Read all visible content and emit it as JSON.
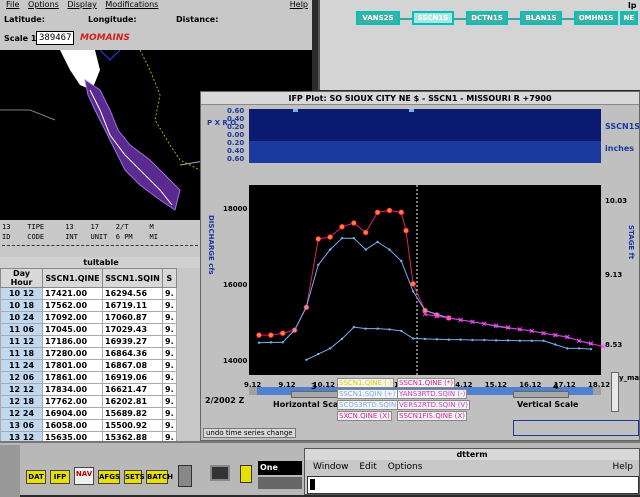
{
  "map": {
    "menu": [
      "File",
      "Options",
      "Display",
      "Modifications"
    ],
    "coords": {
      "lat": "Latitude:",
      "lon": "Longitude:",
      "dist": "Distance:"
    },
    "scale_label": "Scale 1:",
    "scale_value": "389467",
    "scale_unit": "MOMAINS",
    "help": "Help"
  },
  "tree": {
    "help": "lp",
    "nodes": [
      "VANS2S",
      "SSCN1S",
      "DCTN1S",
      "BLAN1S",
      "OMHN1S",
      "NE"
    ]
  },
  "ifp": {
    "title": "IFP Plot: SO SIOUX CITY NE   $ - SSCN1  -  MISSOURI R   +7900",
    "precip_label": "P X R O",
    "precip_ticks": [
      "0.60",
      "0.40",
      "0.20",
      "0.00",
      "0.20",
      "0.40",
      "0.60"
    ],
    "right_label": "SSCN1S",
    "unit_label": "inches",
    "yaxis_left": "DISCHARGE cfs",
    "yaxis_right": "STAGE ft",
    "yticks_left": [
      "18000",
      "16000",
      "14000"
    ],
    "yticks_right": [
      "10.03",
      "9.13",
      "8.53"
    ],
    "xticks": [
      "9.12",
      "9.12",
      "10.12",
      "11.12",
      "12.12",
      "13.12",
      "14.12",
      "15.12",
      "16.12",
      "17.12",
      "18.12"
    ],
    "horizontal_scale_label": "Horizontal Scale",
    "horizontal_scale_value": "3",
    "vertical_scale_label": "Vertical Scale",
    "vertical_scale_value": "4",
    "date_label": "2/2002 Z",
    "undo_label": "undo time series change",
    "y_max_label": "y_max",
    "legend": [
      {
        "label": "SSCN1.QINE (-)",
        "color": "#e8d000"
      },
      {
        "label": "SSCN1.QINE (*)",
        "color": "#e02090"
      },
      {
        "label": "SSCN1.SQIN (+)",
        "color": "#7ab0f0"
      },
      {
        "label": "YANS3RTD.SQIN (-)",
        "color": "#d040d0"
      },
      {
        "label": "SCOS3RTD.SQIN (S)",
        "color": "#7ab0f0"
      },
      {
        "label": "VERS2RTD.SQIN (V)",
        "color": "#d040d0"
      },
      {
        "label": "SXCN.QINE (X)",
        "color": "#e02090"
      },
      {
        "label": "SSCN1FIS.QINE (X)",
        "color": "#e02090"
      }
    ]
  },
  "chart_data": {
    "type": "line",
    "x_ticks": [
      "9.12",
      "9.12",
      "10.12",
      "11.12",
      "12.12",
      "13.12",
      "14.12",
      "15.12",
      "16.12",
      "17.12",
      "18.12"
    ],
    "ylim": [
      13600,
      18600
    ],
    "series": [
      {
        "name": "SSCN1.QINE",
        "color": "#ff8040",
        "values": [
          [
            0,
            14650
          ],
          [
            0.5,
            14650
          ],
          [
            1,
            14700
          ],
          [
            1.5,
            14780
          ],
          [
            2,
            15380
          ],
          [
            2.5,
            17180
          ],
          [
            3,
            17230
          ],
          [
            3.5,
            17500
          ],
          [
            4,
            17600
          ],
          [
            4.5,
            17350
          ],
          [
            5,
            17880
          ],
          [
            5.5,
            17930
          ],
          [
            6,
            17880
          ],
          [
            6.2,
            17400
          ],
          [
            6.5,
            16000
          ],
          [
            7,
            15300
          ],
          [
            7.5,
            15180
          ],
          [
            8,
            15100
          ]
        ]
      },
      {
        "name": "SSCN1.SQIN",
        "color": "#7ab0f0",
        "values": [
          [
            0,
            14450
          ],
          [
            0.5,
            14460
          ],
          [
            1,
            14460
          ],
          [
            1.5,
            14780
          ],
          [
            2,
            15400
          ],
          [
            2.5,
            16500
          ],
          [
            3,
            16900
          ],
          [
            3.5,
            17200
          ],
          [
            4,
            17200
          ],
          [
            4.5,
            16900
          ],
          [
            5,
            17100
          ],
          [
            5.5,
            16900
          ],
          [
            6,
            16600
          ],
          [
            6.5,
            15800
          ],
          [
            7,
            15300
          ],
          [
            7.5,
            15200
          ],
          [
            8,
            15100
          ],
          [
            8.5,
            15050
          ],
          [
            9,
            15000
          ],
          [
            9.5,
            14950
          ],
          [
            10,
            14880
          ],
          [
            10.5,
            14840
          ],
          [
            11,
            14800
          ],
          [
            11.5,
            14760
          ],
          [
            12,
            14700
          ],
          [
            12.5,
            14650
          ],
          [
            13,
            14600
          ],
          [
            13.5,
            14500
          ],
          [
            14,
            14420
          ]
        ]
      },
      {
        "name": "SCOS3RTD.SQIN",
        "color": "#7ab0f0",
        "values": [
          [
            2,
            14000
          ],
          [
            2.5,
            14150
          ],
          [
            3,
            14300
          ],
          [
            3.5,
            14550
          ],
          [
            4,
            14860
          ],
          [
            4.5,
            14820
          ],
          [
            5,
            14820
          ],
          [
            5.5,
            14800
          ],
          [
            6,
            14760
          ],
          [
            6.5,
            14560
          ],
          [
            7,
            14550
          ],
          [
            7.5,
            14540
          ],
          [
            8,
            14530
          ],
          [
            8.5,
            14530
          ],
          [
            9,
            14520
          ],
          [
            9.5,
            14520
          ],
          [
            10,
            14510
          ],
          [
            10.5,
            14510
          ],
          [
            11,
            14500
          ],
          [
            11.5,
            14500
          ],
          [
            12,
            14500
          ],
          [
            12.5,
            14400
          ],
          [
            13,
            14300
          ],
          [
            13.5,
            14300
          ],
          [
            14,
            14280
          ]
        ]
      },
      {
        "name": "SXCN.QINE",
        "color": "#d040d0",
        "values": [
          [
            7,
            15200
          ],
          [
            7.5,
            15150
          ],
          [
            8,
            15100
          ],
          [
            8.5,
            15050
          ],
          [
            9,
            15000
          ],
          [
            9.5,
            14950
          ],
          [
            10,
            14900
          ],
          [
            10.5,
            14850
          ],
          [
            11,
            14800
          ],
          [
            11.5,
            14760
          ],
          [
            12,
            14700
          ],
          [
            12.5,
            14650
          ],
          [
            13,
            14600
          ],
          [
            13.5,
            14500
          ],
          [
            14,
            14430
          ],
          [
            14.5,
            14350
          ]
        ]
      }
    ]
  },
  "table": {
    "strip_line1": "13    TIPE     13    17    2/T     M",
    "strip_line2": "ID    CODE     INT   UNIT  6 PM    MI",
    "title": "tultable",
    "headers": [
      "Day Hour",
      "SSCN1.QINE",
      "SSCN1.SQIN",
      "S"
    ],
    "rows": [
      [
        "10 12",
        "17421.00",
        "16294.56",
        "9."
      ],
      [
        "10 18",
        "17562.00",
        "16719.11",
        "9."
      ],
      [
        "10 24",
        "17092.00",
        "17060.87",
        "9."
      ],
      [
        "11 06",
        "17045.00",
        "17029.43",
        "9."
      ],
      [
        "11 12",
        "17186.00",
        "16939.27",
        "9."
      ],
      [
        "11 18",
        "17280.00",
        "16864.36",
        "9."
      ],
      [
        "11 24",
        "17801.00",
        "16867.08",
        "9."
      ],
      [
        "12 06",
        "17861.00",
        "16919.06",
        "9."
      ],
      [
        "12 12",
        "17834.00",
        "16621.47",
        "9."
      ],
      [
        "12 18",
        "17762.00",
        "16202.81",
        "9."
      ],
      [
        "12 24",
        "16904.00",
        "15689.82",
        "9."
      ],
      [
        "13 06",
        "16058.00",
        "15500.92",
        "9."
      ],
      [
        "13 12",
        "15635.00",
        "15362.88",
        "9."
      ]
    ]
  },
  "taskbar": {
    "buttons": [
      "DAT",
      "IFP",
      "NAV",
      "AFGS",
      "SETS",
      "BATCH"
    ],
    "workspace": "One"
  },
  "dtterm": {
    "title": "dtterm",
    "menu": [
      "Window",
      "Edit",
      "Options"
    ],
    "help": "Help"
  }
}
